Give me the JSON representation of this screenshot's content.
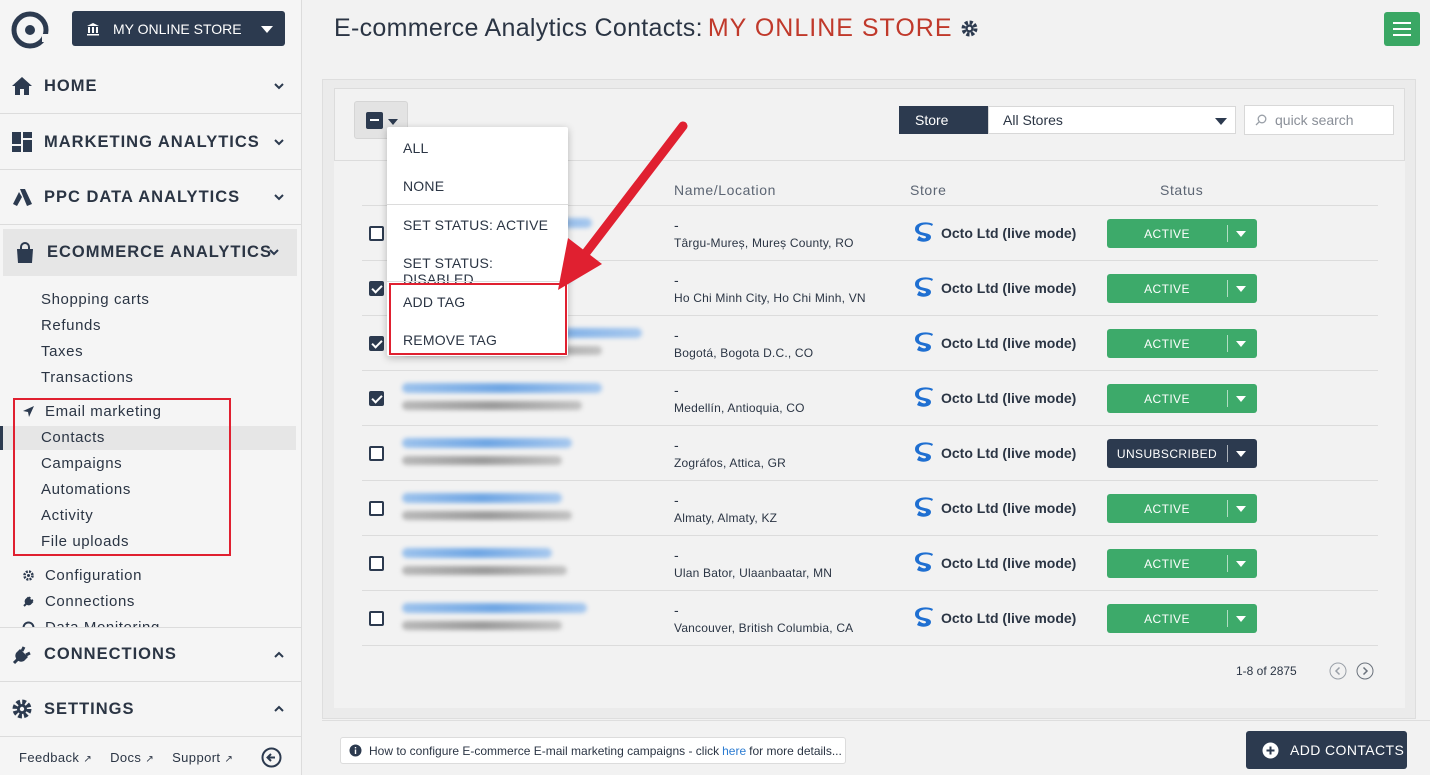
{
  "sidebar": {
    "store_button": "MY ONLINE STORE",
    "sections": {
      "home": "HOME",
      "marketing": "MARKETING ANALYTICS",
      "ppc": "PPC DATA ANALYTICS",
      "ecommerce": "ECOMMERCE ANALYTICS",
      "connections": "CONNECTIONS",
      "settings": "SETTINGS"
    },
    "ecommerce_items": [
      "Shopping carts",
      "Refunds",
      "Taxes",
      "Transactions"
    ],
    "email_marketing": "Email marketing",
    "email_items": [
      "Contacts",
      "Campaigns",
      "Automations",
      "Activity",
      "File uploads"
    ],
    "config": "Configuration",
    "connections_item": "Connections",
    "data_monitoring": "Data Monitoring",
    "footer": {
      "feedback": "Feedback",
      "docs": "Docs",
      "support": "Support"
    }
  },
  "header": {
    "title": "E-commerce Analytics Contacts:",
    "store": "MY ONLINE STORE"
  },
  "toolbar": {
    "store_label": "Store",
    "store_value": "All Stores",
    "search_placeholder": "quick search"
  },
  "dropdown": {
    "items": [
      "ALL",
      "NONE",
      "SET STATUS: ACTIVE",
      "SET STATUS: DISABLED",
      "ADD TAG",
      "REMOVE TAG"
    ]
  },
  "table": {
    "columns": [
      "Name/Location",
      "Store",
      "Status"
    ],
    "rows": [
      {
        "checked": false,
        "name": "-",
        "location": "Târgu-Mureș, Mureș County, RO",
        "store": "Octo Ltd (live mode)",
        "status": "ACTIVE"
      },
      {
        "checked": true,
        "name": "-",
        "location": "Ho Chi Minh City, Ho Chi Minh, VN",
        "store": "Octo Ltd (live mode)",
        "status": "ACTIVE"
      },
      {
        "checked": true,
        "name": "-",
        "location": "Bogotá, Bogota D.C., CO",
        "store": "Octo Ltd (live mode)",
        "status": "ACTIVE"
      },
      {
        "checked": true,
        "name": "-",
        "location": "Medellín, Antioquia, CO",
        "store": "Octo Ltd (live mode)",
        "status": "ACTIVE"
      },
      {
        "checked": false,
        "name": "-",
        "location": "Zográfos, Attica, GR",
        "store": "Octo Ltd (live mode)",
        "status": "UNSUBSCRIBED"
      },
      {
        "checked": false,
        "name": "-",
        "location": "Almaty, Almaty, KZ",
        "store": "Octo Ltd (live mode)",
        "status": "ACTIVE"
      },
      {
        "checked": false,
        "name": "-",
        "location": "Ulan Bator, Ulaanbaatar, MN",
        "store": "Octo Ltd (live mode)",
        "status": "ACTIVE"
      },
      {
        "checked": false,
        "name": "-",
        "location": "Vancouver, British Columbia, CA",
        "store": "Octo Ltd (live mode)",
        "status": "ACTIVE"
      }
    ],
    "pagination": "1-8 of 2875"
  },
  "footer_bar": {
    "info_pre": "How to configure E-commerce E-mail marketing campaigns - click",
    "info_link": "here",
    "info_post": "for more details...",
    "add_button": "ADD CONTACTS"
  },
  "colors": {
    "primary": "#2c3a4f",
    "active": "#3daa6a",
    "accent_red": "#c0392b",
    "annotation": "#e02030"
  }
}
